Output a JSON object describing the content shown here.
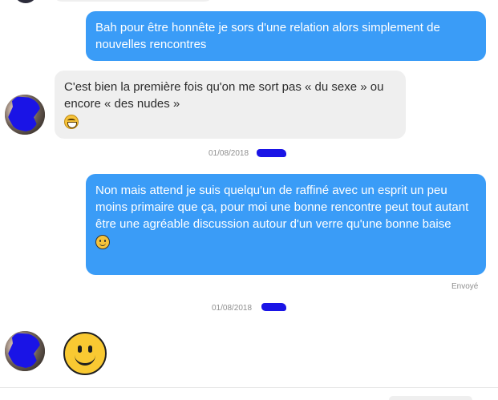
{
  "conversation": {
    "messages": [
      {
        "direction": "outgoing",
        "text": "Bah pour être honnête je sors d'une relation alors simplement de nouvelles rencontres"
      },
      {
        "direction": "incoming",
        "text": "C'est bien la première fois qu'on me sort pas « du sexe » ou encore « des nudes »",
        "emoji": "laughing-emoji"
      },
      {
        "direction": "outgoing",
        "text": "Non mais attend je suis quelqu'un de raffiné avec un esprit un peu moins primaire que ça, pour moi une bonne rencontre peut tout autant être une agréable discussion autour d'un verre qu'une bonne baise",
        "emoji": "smiling-emoji",
        "status": "Envoyé"
      },
      {
        "direction": "incoming",
        "emoji": "smiling-emoji"
      }
    ],
    "timestamps": [
      "01/08/2018",
      "01/08/2018"
    ]
  },
  "colors": {
    "outgoing_bubble": "#3a9cf7",
    "incoming_bubble": "#efefef",
    "redaction": "#1a14e6",
    "meta_text": "#8f8f8f"
  }
}
